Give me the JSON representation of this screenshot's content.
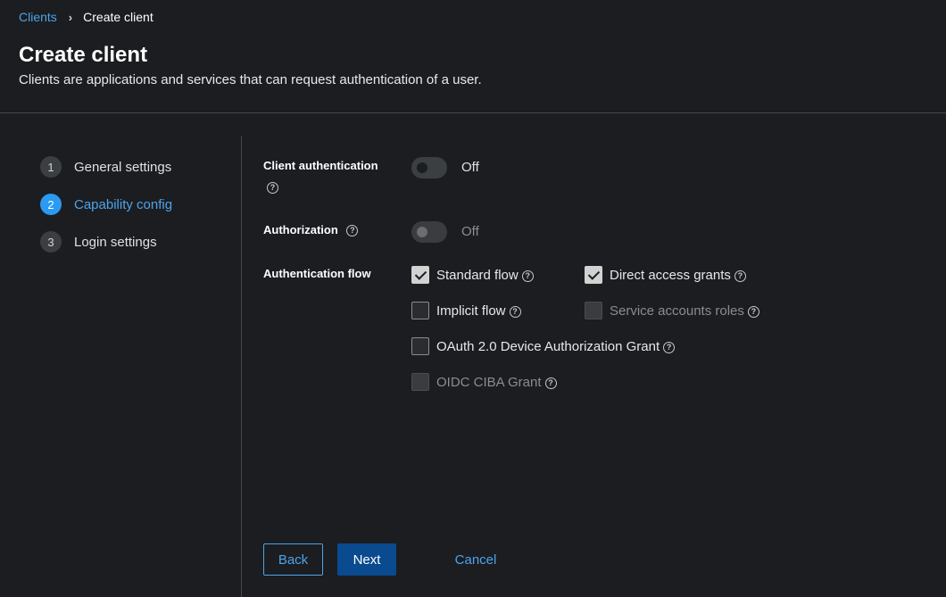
{
  "breadcrumb": {
    "parent": "Clients",
    "current": "Create client"
  },
  "header": {
    "title": "Create client",
    "description": "Clients are applications and services that can request authentication of a user."
  },
  "steps": [
    {
      "number": "1",
      "label": "General settings",
      "active": false
    },
    {
      "number": "2",
      "label": "Capability config",
      "active": true
    },
    {
      "number": "3",
      "label": "Login settings",
      "active": false
    }
  ],
  "fields": {
    "client_authentication": {
      "label": "Client authentication",
      "state": "Off"
    },
    "authorization": {
      "label": "Authorization",
      "state": "Off"
    },
    "authentication_flow": {
      "label": "Authentication flow",
      "options": {
        "standard_flow": "Standard flow",
        "direct_access_grants": "Direct access grants",
        "implicit_flow": "Implicit flow",
        "service_accounts_roles": "Service accounts roles",
        "oauth_device": "OAuth 2.0 Device Authorization Grant",
        "oidc_ciba": "OIDC CIBA Grant"
      }
    }
  },
  "help_glyph": "?",
  "buttons": {
    "back": "Back",
    "next": "Next",
    "cancel": "Cancel"
  },
  "colors": {
    "accent": "#2b9af3",
    "link": "#4fa3e8",
    "primary_button": "#0a4b8f",
    "background": "#1b1d21"
  }
}
